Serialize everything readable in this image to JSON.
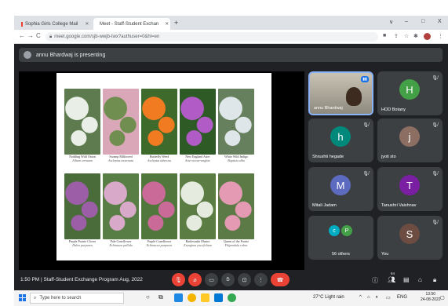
{
  "browser": {
    "tabs": [
      {
        "label": "Sophia Girls College Mail",
        "active": false
      },
      {
        "label": "Meet - Staff-Student Exchan",
        "active": true
      }
    ],
    "new_tab": "+",
    "url": "meet.google.com/sjb-wwjb-twx?authuser=0&hl=en",
    "nav": {
      "back": "←",
      "forward": "→",
      "reload": "C"
    },
    "window": {
      "dropdown": "∨",
      "minimize": "–",
      "maximize": "□",
      "close": "X"
    }
  },
  "presenting": {
    "text": "annu Bhardwaj is presenting"
  },
  "slide": {
    "plants": [
      {
        "name": "Nodding Wild Onion",
        "sci": "Allium cernuum",
        "color1": "#e9efe6",
        "color2": "#5d7b4e"
      },
      {
        "name": "Swamp Milkweed",
        "sci": "Asclepias incarnata",
        "color1": "#6f8e4f",
        "color2": "#d9a7b7"
      },
      {
        "name": "Butterfly Weed",
        "sci": "Asclepias tuberosa",
        "color1": "#f07b21",
        "color2": "#3e6a2b"
      },
      {
        "name": "New England Aster",
        "sci": "Aster novae-angliae",
        "color1": "#b05bc6",
        "color2": "#2e5a25"
      },
      {
        "name": "White Wild Indigo",
        "sci": "Baptisia alba",
        "color1": "#dfe6ea",
        "color2": "#667f5c"
      },
      {
        "name": "Purple Prairie Clover",
        "sci": "Dalea purpurea",
        "color1": "#9c5fa7",
        "color2": "#4a6b3a"
      },
      {
        "name": "Pale Coneflower",
        "sci": "Echinacea pallida",
        "color1": "#d8a9c8",
        "color2": "#587e45"
      },
      {
        "name": "Purple Coneflower",
        "sci": "Echinacea purpurea",
        "color1": "#c96a98",
        "color2": "#52773d"
      },
      {
        "name": "Rattlesnake Master",
        "sci": "Eryngium yuccifolium",
        "color1": "#e6ebdf",
        "color2": "#5b7d44"
      },
      {
        "name": "Queen of the Prairie",
        "sci": "Filipendula rubra",
        "color1": "#e59ab4",
        "color2": "#5c7a46"
      }
    ]
  },
  "participants": [
    {
      "name": "annu Bhardwaj",
      "initial": "",
      "color": "#5f6368",
      "video": true
    },
    {
      "name": "HOD Botany",
      "initial": "H",
      "color": "#43a047"
    },
    {
      "name": "Shrushti hegade",
      "initial": "h",
      "color": "#00897b"
    },
    {
      "name": "jyoti sto",
      "initial": "j",
      "color": "#8d6e63"
    },
    {
      "name": "Mitali Jadam",
      "initial": "M",
      "color": "#5c6bc0"
    },
    {
      "name": "Tanushri Vaishnav",
      "initial": "T",
      "color": "#7b1fa2"
    },
    {
      "name": "56 others",
      "initial": "",
      "color": "#3c4043"
    },
    {
      "name": "You",
      "initial": "S",
      "color": "#6d4c41"
    }
  ],
  "others_avatars": [
    {
      "initial": "c",
      "color": "#00acc1"
    },
    {
      "initial": "P",
      "color": "#43a047"
    }
  ],
  "controls": {
    "time": "1:50 PM",
    "separator": "|",
    "meeting_name": "Staff-Student Exchange Program Aug, 2022",
    "people_count": "64"
  },
  "taskbar": {
    "search_placeholder": "Type here to search",
    "weather": "27°C  Light rain",
    "lang": "ENG",
    "time": "13:50",
    "date": "24-08-2022"
  }
}
